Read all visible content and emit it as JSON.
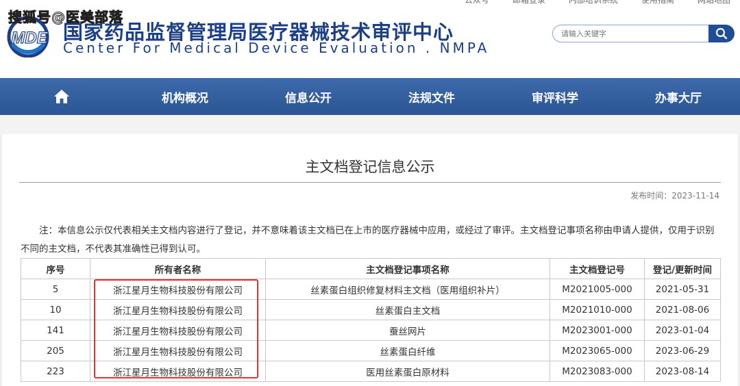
{
  "watermark": "搜狐号@医美部落",
  "top_links": [
    "公众号",
    "邮箱登录",
    "内部培训系统",
    "使用指南",
    "网站地图"
  ],
  "logo": {
    "mark": "MDE",
    "title": "国家药品监督管理局医疗器械技术审评中心",
    "subtitle": "Center For Medical Device Evaluation . NMPA"
  },
  "search": {
    "placeholder": "请输入关键字"
  },
  "nav": {
    "home_icon": "home-icon",
    "items": [
      "机构概况",
      "信息公开",
      "法规文件",
      "审评科学",
      "办事大厅"
    ]
  },
  "page": {
    "title": "主文档登记信息公示",
    "publish_label": "发布时间：",
    "publish_date": "2023-11-14",
    "note": "注：本信息公示仅代表相关主文档内容进行了登记，并不意味着该主文档已在上市的医疗器械中应用，或经过了审评。主文档登记事项名称由申请人提供，仅用于识别不同的主文档，不代表其准确性已得到认可。"
  },
  "table": {
    "headers": [
      "序号",
      "所有者名称",
      "主文档登记事项名称",
      "主文档登记号",
      "登记/更新时间"
    ],
    "rows": [
      [
        "5",
        "浙江星月生物科技股份有限公司",
        "丝素蛋白组织修复材料主文档（医用组织补片）",
        "M2021005-000",
        "2021-05-31"
      ],
      [
        "10",
        "浙江星月生物科技股份有限公司",
        "丝素蛋白主文档",
        "M2021010-000",
        "2021-08-06"
      ],
      [
        "141",
        "浙江星月生物科技股份有限公司",
        "蚕丝网片",
        "M2023001-000",
        "2023-01-04"
      ],
      [
        "205",
        "浙江星月生物科技股份有限公司",
        "丝素蛋白纤维",
        "M2023065-000",
        "2023-06-29"
      ],
      [
        "223",
        "浙江星月生物科技股份有限公司",
        "医用丝素蛋白原材料",
        "M2023083-000",
        "2023-08-14"
      ]
    ]
  },
  "colors": {
    "brand_blue": "#1c3f86",
    "nav_blue": "#2b5594",
    "highlight_red": "#e8312f"
  }
}
